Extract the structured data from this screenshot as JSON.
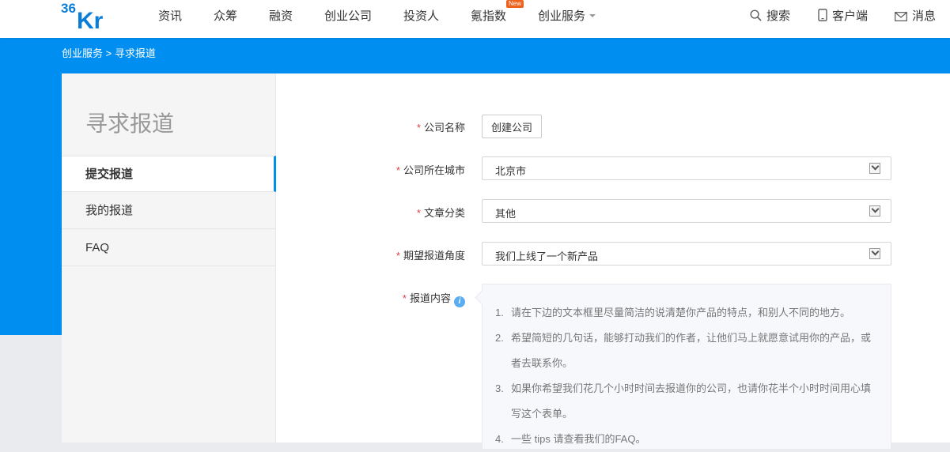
{
  "header": {
    "logo_text": "36Kr",
    "nav": [
      {
        "label": "资讯"
      },
      {
        "label": "众筹"
      },
      {
        "label": "融资"
      },
      {
        "label": "创业公司"
      },
      {
        "label": "投资人"
      },
      {
        "label": "氪指数",
        "badge": "New"
      },
      {
        "label": "创业服务",
        "dropdown": true
      }
    ],
    "search_label": "搜索",
    "client_label": "客户端",
    "message_label": "消息"
  },
  "breadcrumb": {
    "parent": "创业服务",
    "separator": ">",
    "current": "寻求报道"
  },
  "sidebar": {
    "title": "寻求报道",
    "items": [
      {
        "label": "提交报道",
        "active": true
      },
      {
        "label": "我的报道",
        "active": false
      },
      {
        "label": "FAQ",
        "active": false
      }
    ]
  },
  "form": {
    "required_mark": "*",
    "company_label": "公司名称",
    "create_company_button": "创建公司",
    "city_label": "公司所在城市",
    "city_value": "北京市",
    "category_label": "文章分类",
    "category_value": "其他",
    "angle_label": "期望报道角度",
    "angle_value": "我们上线了一个新产品",
    "content_label": "报道内容",
    "tips": [
      {
        "num": "1.",
        "text": "请在下边的文本框里尽量简洁的说清楚你产品的特点，和别人不同的地方。"
      },
      {
        "num": "2.",
        "text": "希望简短的几句话，能够打动我们的作者，让他们马上就愿意试用你的产品，或者去联系你。"
      },
      {
        "num": "3.",
        "text": "如果你希望我们花几个小时时间去报道你的公司，也请你花半个小时时间用心填写这个表单。"
      },
      {
        "num": "4.",
        "text": "一些 tips 请查看我们的FAQ。"
      }
    ]
  },
  "colors": {
    "brand_blue": "#008ef0",
    "required_red": "#e04040",
    "badge_orange": "#f0611e"
  }
}
